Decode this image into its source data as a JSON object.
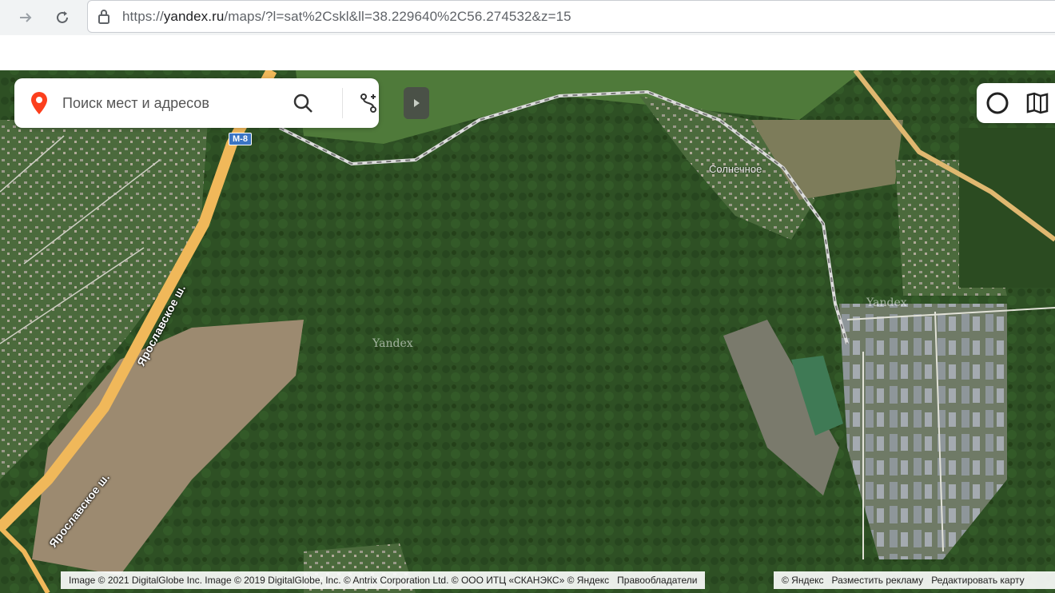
{
  "browser": {
    "url_prefix": "https://",
    "url_domain": "yandex.ru",
    "url_path": "/maps/?l=sat%2Cskl&ll=38.229640%2C56.274532&z=15"
  },
  "search": {
    "placeholder": "Поиск мест и адресов"
  },
  "map": {
    "shield": "M-8",
    "road_label_upper": "Ярославское ш.",
    "road_label_lower": "Ярославское ш.",
    "place_label": "Солнечное",
    "watermark_1": "Yandex",
    "watermark_2": "Yandex"
  },
  "footer": {
    "attribution": "Image © 2021 DigitalGlobe Inc. Image © 2019 DigitalGlobe, Inc. © Antrix Corporation Ltd. © ООО ИТЦ «СКАНЭКС» © Яндекс",
    "rights_holders": "Правообладатели",
    "yandex": "© Яндекс",
    "advertise": "Разместить рекламу",
    "edit_map": "Редактировать карту"
  },
  "colors": {
    "forest": "#2f5126",
    "field": "#9c8a70",
    "highway": "#f0b85a",
    "pin": "#fc3f1d"
  },
  "icons": [
    "arrow-forward-icon",
    "reload-icon",
    "lock-icon",
    "location-pin-icon",
    "search-icon",
    "route-icon",
    "collapse-arrow-icon",
    "alice-icon",
    "layers-icon"
  ]
}
